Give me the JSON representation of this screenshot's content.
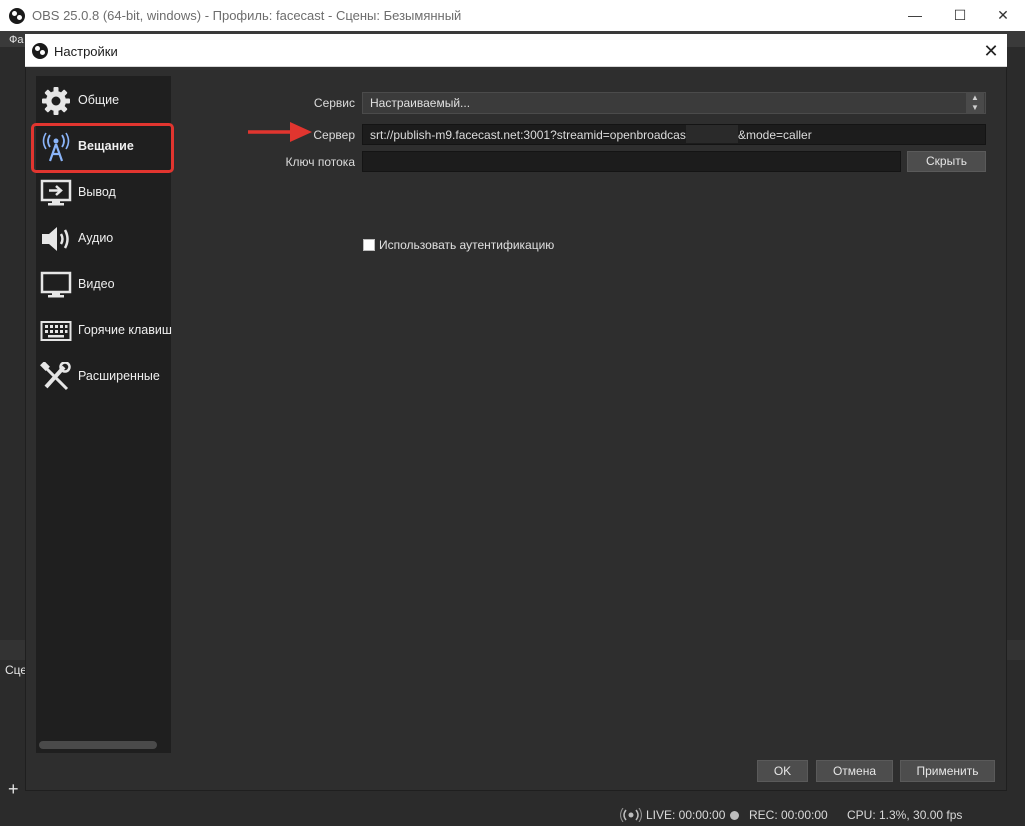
{
  "main_window": {
    "title": "OBS 25.0.8 (64-bit, windows) - Профиль: facecast - Сцены: Безымянный",
    "menu_partial": "Фа",
    "scenes_partial": "Сце",
    "controls": {
      "minimize": "—",
      "maximize": "☐",
      "close": "✕"
    }
  },
  "status": {
    "live": "LIVE: 00:00:00",
    "rec": "REC: 00:00:00",
    "cpu": "CPU: 1.3%, 30.00 fps"
  },
  "dialog": {
    "title": "Настройки",
    "close": "✕",
    "sidebar": [
      {
        "label": "Общие",
        "icon": "gear-icon"
      },
      {
        "label": "Вещание",
        "icon": "broadcast-antenna-icon",
        "selected": true
      },
      {
        "label": "Вывод",
        "icon": "output-monitor-icon"
      },
      {
        "label": "Аудио",
        "icon": "speaker-icon"
      },
      {
        "label": "Видео",
        "icon": "monitor-icon"
      },
      {
        "label": "Горячие клавиш",
        "icon": "keyboard-icon"
      },
      {
        "label": "Расширенные",
        "icon": "tools-icon"
      }
    ],
    "form": {
      "service_label": "Сервис",
      "service_value": "Настраиваемый...",
      "server_label": "Сервер",
      "server_value_start": "srt://publish-m9.facecast.net:3001?streamid=openbroadcaster@",
      "server_value_end": "&mode=caller",
      "key_label": "Ключ потока",
      "key_value": "",
      "hide_button": "Скрыть",
      "auth_label": "Использовать аутентификацию",
      "auth_checked": false
    },
    "buttons": {
      "ok": "OK",
      "cancel": "Отмена",
      "apply": "Применить"
    }
  },
  "colors": {
    "accent_highlight": "#e1352f",
    "dialog_bg": "#2e2e2e",
    "sidebar_bg": "#1f1f1f"
  }
}
